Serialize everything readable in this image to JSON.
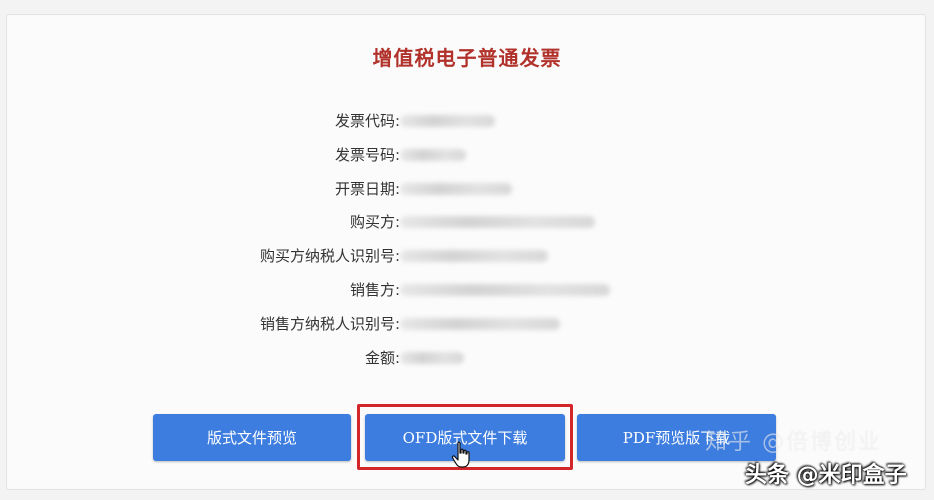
{
  "invoice": {
    "title": "增值税电子普通发票",
    "fields": [
      {
        "label": "发票代码:"
      },
      {
        "label": "发票号码:"
      },
      {
        "label": "开票日期:"
      },
      {
        "label": "购买方:"
      },
      {
        "label": "购买方纳税人识别号:"
      },
      {
        "label": "销售方:"
      },
      {
        "label": "销售方纳税人识别号:"
      },
      {
        "label": "金额:"
      }
    ]
  },
  "actions": {
    "preview_label": "版式文件预览",
    "ofd_download_label": "OFD版式文件下载",
    "pdf_download_label": "PDF预览版下载"
  },
  "watermarks": {
    "zhihu": "知乎 @倍博创业",
    "toutiao": "头条 @米印盒子"
  },
  "colors": {
    "title": "#b1312b",
    "button": "#3d7de0",
    "highlight": "#d3262a"
  }
}
